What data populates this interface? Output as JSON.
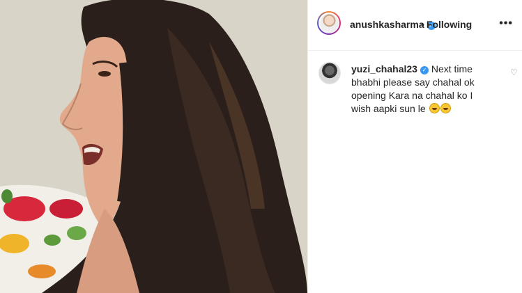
{
  "post": {
    "author": "anushkasharma",
    "follow_separator": "•",
    "follow_status": "Following",
    "more_label": "•••"
  },
  "comment": {
    "username": "yuzi_chahal23",
    "text": "Next time bhabhi please say chahal ok opening Kara na chahal ko I wish aapki sun le",
    "emojis": [
      "rolling-on-floor-laughing-emoji",
      "rolling-on-floor-laughing-emoji"
    ]
  },
  "icons": {
    "verified": "verified-badge-icon",
    "like": "heart-icon",
    "more": "more-options-icon"
  },
  "colors": {
    "verified_blue": "#3897f0",
    "text": "#262626",
    "border": "#efefef",
    "muted": "#8e8e8e"
  }
}
